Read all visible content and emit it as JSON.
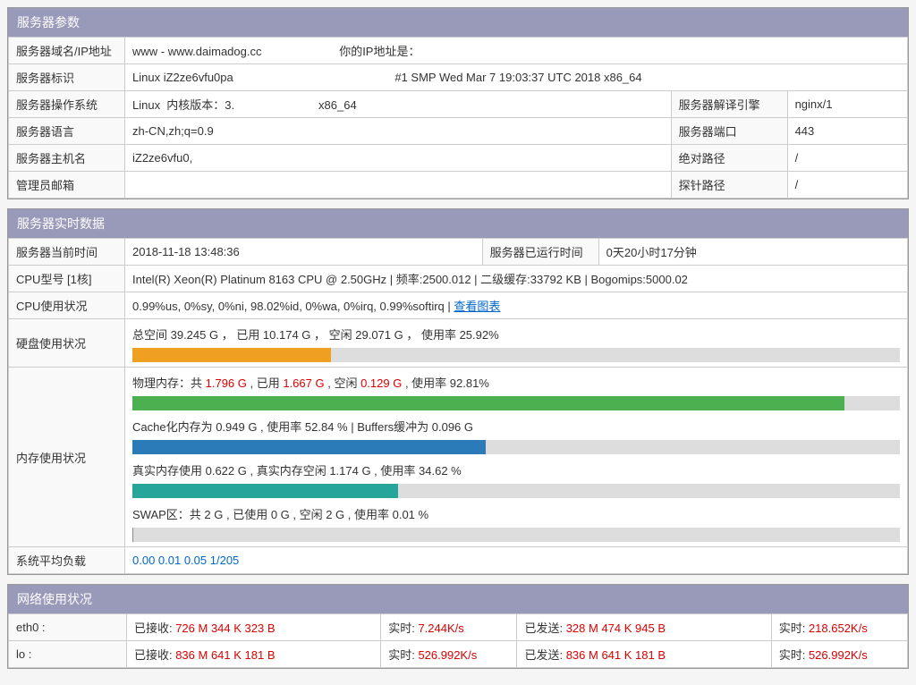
{
  "panel1": {
    "title": "服务器参数",
    "rows": {
      "r1": {
        "label": "服务器域名/IP地址",
        "v1": "www - www.daimadog.cc",
        "v2": "你的IP地址是："
      },
      "r2": {
        "label": "服务器标识",
        "value": "Linux iZ2ze6vfu0pa                                                  #1 SMP Wed Mar 7 19:03:37 UTC 2018 x86_64"
      },
      "r3": {
        "label1": "服务器操作系统",
        "value1": "Linux  内核版本：3.                          x86_64",
        "label2": "服务器解译引擎",
        "value2": "nginx/1"
      },
      "r4": {
        "label1": "服务器语言",
        "value1": "zh-CN,zh;q=0.9",
        "label2": "服务器端口",
        "value2": "443"
      },
      "r5": {
        "label1": "服务器主机名",
        "value1": "iZ2ze6vfu0,",
        "label2": "绝对路径",
        "value2": "/"
      },
      "r6": {
        "label1": "管理员邮箱",
        "value1": "",
        "label2": "探针路径",
        "value2": "/"
      }
    }
  },
  "panel2": {
    "title": "服务器实时数据",
    "currentTime": {
      "label": "服务器当前时间",
      "value": "2018-11-18 13:48:36"
    },
    "uptime": {
      "label": "服务器已运行时间",
      "value": "0天20小时17分钟"
    },
    "cpuModel": {
      "label": "CPU型号 [1核]",
      "value": "Intel(R) Xeon(R) Platinum 8163 CPU @ 2.50GHz | 频率:2500.012 | 二级缓存:33792 KB | Bogomips:5000.02"
    },
    "cpuUsage": {
      "label": "CPU使用状况",
      "value": "0.99%us, 0%sy, 0%ni, 98.02%id, 0%wa, 0%irq, 0.99%softirq | ",
      "link": "查看图表"
    },
    "disk": {
      "label": "硬盘使用状况",
      "text": "总空间 39.245 G ， 已用 10.174 G ， 空闲 29.071 G ， 使用率 25.92%",
      "pct": 25.92
    },
    "mem": {
      "label": "内存使用状况",
      "phys_prefix": "物理内存：共 ",
      "phys_total": "1.796 G",
      "phys_used_label": " , 已用 ",
      "phys_used": "1.667 G",
      "phys_free_label": " , 空闲 ",
      "phys_free": "0.129 G",
      "phys_rate_label": " , 使用率 92.81%",
      "phys_pct": 92.81,
      "cache": "Cache化内存为 0.949 G , 使用率 52.84 % | Buffers缓冲为 0.096 G",
      "cache_pct": 46,
      "real": "真实内存使用 0.622 G , 真实内存空闲 1.174 G , 使用率 34.62 %",
      "real_pct": 34.62,
      "swap": "SWAP区：共 2 G , 已使用 0 G , 空闲 2 G , 使用率 0.01 %",
      "swap_pct": 0.01
    },
    "loadAvg": {
      "label": "系统平均负载",
      "value": "0.00 0.01 0.05 1/205"
    }
  },
  "panel3": {
    "title": "网络使用状况",
    "eth0": {
      "iface": "eth0 :",
      "rx_label": "已接收: ",
      "rx": "726 M 344 K 323 B",
      "rx_rt_label": "实时: ",
      "rx_rt": "7.244K/s",
      "tx_label": "已发送: ",
      "tx": "328 M 474 K 945 B",
      "tx_rt_label": "实时: ",
      "tx_rt": "218.652K/s"
    },
    "lo": {
      "iface": "lo :",
      "rx_label": "已接收: ",
      "rx": "836 M 641 K 181 B",
      "rx_rt_label": "实时: ",
      "rx_rt": "526.992K/s",
      "tx_label": "已发送: ",
      "tx": "836 M 641 K 181 B",
      "tx_rt_label": "实时: ",
      "tx_rt": "526.992K/s"
    }
  }
}
